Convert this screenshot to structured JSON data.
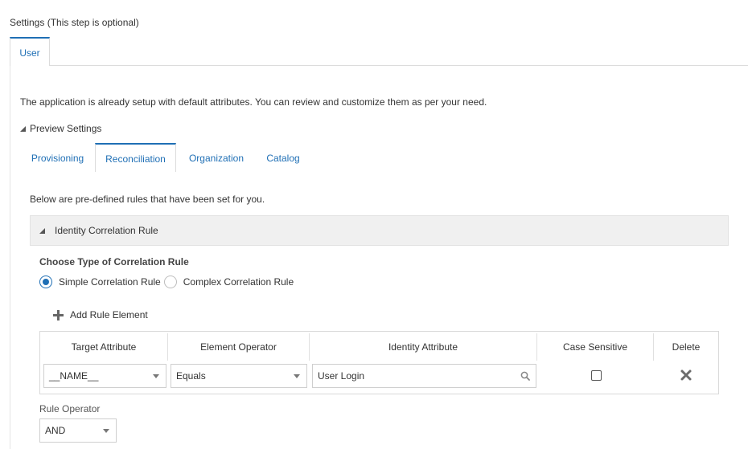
{
  "page": {
    "title": "Settings (This step is optional)",
    "intro": "The application is already setup with default attributes. You can review and customize them as per your need."
  },
  "outer_tabs": [
    {
      "label": "User",
      "active": true
    }
  ],
  "preview": {
    "label": "Preview Settings",
    "expanded": true
  },
  "inner_tabs": [
    {
      "label": "Provisioning",
      "active": false
    },
    {
      "label": "Reconciliation",
      "active": true
    },
    {
      "label": "Organization",
      "active": false
    },
    {
      "label": "Catalog",
      "active": false
    }
  ],
  "reconciliation": {
    "rules_text": "Below are pre-defined rules that have been set for you.",
    "section_label": "Identity Correlation Rule",
    "choose_label": "Choose Type of Correlation Rule",
    "radios": [
      {
        "label": "Simple Correlation Rule",
        "checked": true
      },
      {
        "label": "Complex Correlation Rule",
        "checked": false
      }
    ],
    "add_rule_label": "Add Rule Element",
    "table": {
      "headers": [
        "Target Attribute",
        "Element Operator",
        "Identity Attribute",
        "Case Sensitive",
        "Delete"
      ],
      "row": {
        "target_attribute": "__NAME__",
        "element_operator": "Equals",
        "identity_attribute": "User Login",
        "case_sensitive": false
      }
    },
    "rule_operator_label": "Rule Operator",
    "rule_operator_value": "AND"
  },
  "colors": {
    "accent": "#1f6fb5",
    "header_bg": "#f0f0f0",
    "border": "#dcdcdc"
  },
  "icons": [
    "collapse-triangle-icon",
    "plus-icon",
    "chevron-down-icon",
    "search-icon",
    "close-icon"
  ]
}
